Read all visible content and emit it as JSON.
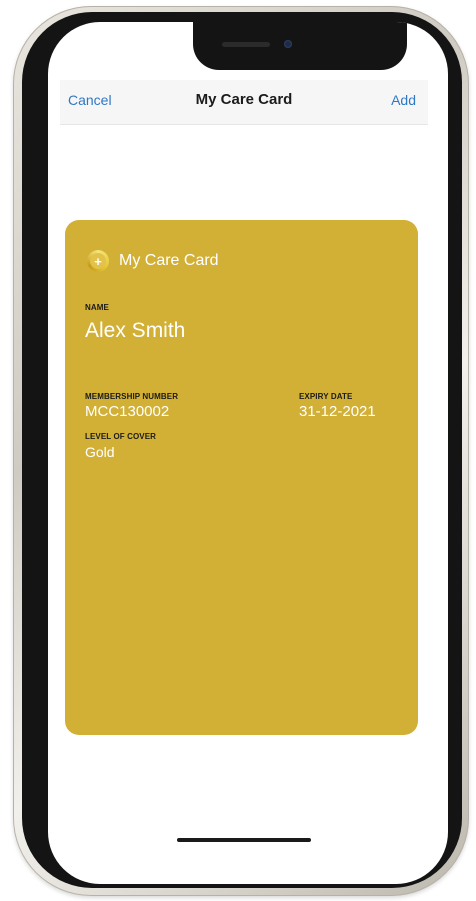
{
  "navbar": {
    "cancel_label": "Cancel",
    "title": "My Care Card",
    "add_label": "Add"
  },
  "card": {
    "brand_name": "My Care Card",
    "brand_icon": "plus-circle-icon",
    "background_color": "#d2b035",
    "fields": {
      "name": {
        "label": "NAME",
        "value": "Alex Smith"
      },
      "membership_number": {
        "label": "MEMBERSHIP NUMBER",
        "value": "MCC130002"
      },
      "expiry_date": {
        "label": "EXPIRY DATE",
        "value": "31-12-2021"
      },
      "level_of_cover": {
        "label": "LEVEL OF COVER",
        "value": "Gold"
      }
    }
  },
  "colors": {
    "link": "#2f78c4",
    "card": "#d2b035"
  }
}
